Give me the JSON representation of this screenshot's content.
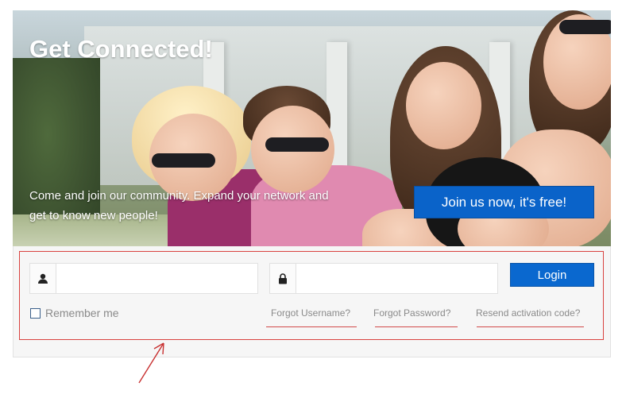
{
  "hero": {
    "title": "Get Connected!",
    "text_line1": "Come and join our community. Expand your network and",
    "text_line2": "get to know new people!",
    "join_label": "Join us now, it's free!"
  },
  "login": {
    "username_icon": "user-icon",
    "password_icon": "lock-icon",
    "login_label": "Login",
    "remember_label": "Remember me",
    "links": [
      "Forgot Username?",
      "Forgot Password?",
      "Resend activation code?"
    ]
  },
  "colors": {
    "accent": "#0a68cf",
    "annotation": "#d24a4a"
  }
}
